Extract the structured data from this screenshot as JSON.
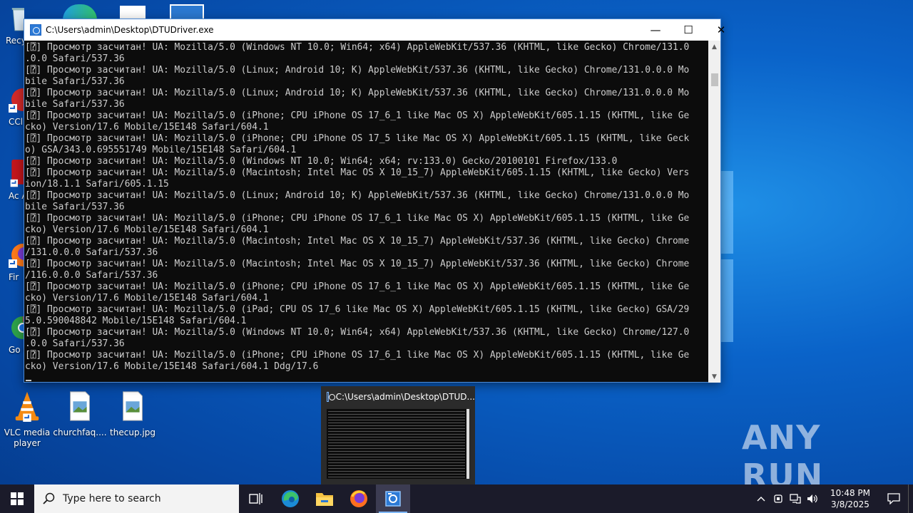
{
  "desktop": {
    "icons": [
      {
        "id": "vlc",
        "label": "VLC media player"
      },
      {
        "id": "churchfaq",
        "label": "churchfaq...."
      },
      {
        "id": "thecup",
        "label": "thecup.jpg"
      }
    ],
    "edge_icons": [
      {
        "id": "recycle",
        "label": "Recy"
      },
      {
        "id": "ccleaner",
        "label": "CCl"
      },
      {
        "id": "acrobat",
        "label": "Ac Acr"
      },
      {
        "id": "firefox",
        "label": "Fir"
      },
      {
        "id": "chrome",
        "label": "Go Chr"
      }
    ],
    "watermark": "ANY RUN"
  },
  "console_window": {
    "title": "C:\\Users\\admin\\Desktop\\DTUDriver.exe",
    "minimize_glyph": "—",
    "maximize_glyph": "☐",
    "close_glyph": "✕",
    "lines": [
      "[⍰] Просмотр засчитан! UA: Mozilla/5.0 (Windows NT 10.0; Win64; x64) AppleWebKit/537.36 (KHTML, like Gecko) Chrome/131.0",
      ".0.0 Safari/537.36",
      "[⍰] Просмотр засчитан! UA: Mozilla/5.0 (Linux; Android 10; K) AppleWebKit/537.36 (KHTML, like Gecko) Chrome/131.0.0.0 Mo",
      "bile Safari/537.36",
      "[⍰] Просмотр засчитан! UA: Mozilla/5.0 (Linux; Android 10; K) AppleWebKit/537.36 (KHTML, like Gecko) Chrome/131.0.0.0 Mo",
      "bile Safari/537.36",
      "[⍰] Просмотр засчитан! UA: Mozilla/5.0 (iPhone; CPU iPhone OS 17_6_1 like Mac OS X) AppleWebKit/605.1.15 (KHTML, like Ge",
      "cko) Version/17.6 Mobile/15E148 Safari/604.1",
      "[⍰] Просмотр засчитан! UA: Mozilla/5.0 (iPhone; CPU iPhone OS 17_5 like Mac OS X) AppleWebKit/605.1.15 (KHTML, like Geck",
      "o) GSA/343.0.695551749 Mobile/15E148 Safari/604.1",
      "[⍰] Просмотр засчитан! UA: Mozilla/5.0 (Windows NT 10.0; Win64; x64; rv:133.0) Gecko/20100101 Firefox/133.0",
      "[⍰] Просмотр засчитан! UA: Mozilla/5.0 (Macintosh; Intel Mac OS X 10_15_7) AppleWebKit/605.1.15 (KHTML, like Gecko) Vers",
      "ion/18.1.1 Safari/605.1.15",
      "[⍰] Просмотр засчитан! UA: Mozilla/5.0 (Linux; Android 10; K) AppleWebKit/537.36 (KHTML, like Gecko) Chrome/131.0.0.0 Mo",
      "bile Safari/537.36",
      "[⍰] Просмотр засчитан! UA: Mozilla/5.0 (iPhone; CPU iPhone OS 17_6_1 like Mac OS X) AppleWebKit/605.1.15 (KHTML, like Ge",
      "cko) Version/17.6 Mobile/15E148 Safari/604.1",
      "[⍰] Просмотр засчитан! UA: Mozilla/5.0 (Macintosh; Intel Mac OS X 10_15_7) AppleWebKit/537.36 (KHTML, like Gecko) Chrome",
      "/131.0.0.0 Safari/537.36",
      "[⍰] Просмотр засчитан! UA: Mozilla/5.0 (Macintosh; Intel Mac OS X 10_15_7) AppleWebKit/537.36 (KHTML, like Gecko) Chrome",
      "/116.0.0.0 Safari/537.36",
      "[⍰] Просмотр засчитан! UA: Mozilla/5.0 (iPhone; CPU iPhone OS 17_6_1 like Mac OS X) AppleWebKit/605.1.15 (KHTML, like Ge",
      "cko) Version/17.6 Mobile/15E148 Safari/604.1",
      "[⍰] Просмотр засчитан! UA: Mozilla/5.0 (iPad; CPU OS 17_6 like Mac OS X) AppleWebKit/605.1.15 (KHTML, like Gecko) GSA/29",
      "5.0.590048842 Mobile/15E148 Safari/604.1",
      "[⍰] Просмотр засчитан! UA: Mozilla/5.0 (Windows NT 10.0; Win64; x64) AppleWebKit/537.36 (KHTML, like Gecko) Chrome/127.0",
      ".0.0 Safari/537.36",
      "[⍰] Просмотр засчитан! UA: Mozilla/5.0 (iPhone; CPU iPhone OS 17_6_1 like Mac OS X) AppleWebKit/605.1.15 (KHTML, like Ge",
      "cko) Version/17.6 Mobile/15E148 Safari/604.1 Ddg/17.6"
    ]
  },
  "thumbnail": {
    "title": "C:\\Users\\admin\\Desktop\\DTUD..."
  },
  "taskbar": {
    "search_placeholder": "Type here to search",
    "apps": [
      "task-view",
      "edge",
      "file-explorer",
      "firefox",
      "console"
    ],
    "clock_time": "10:48 PM",
    "clock_date": "3/8/2025"
  },
  "colors": {
    "desktop_blue": "#0a63c9",
    "console_bg": "#0c0c0c",
    "console_text": "#cccccc",
    "taskbar_bg": "#1b1b2a",
    "window_border": "#4b8ad6"
  }
}
